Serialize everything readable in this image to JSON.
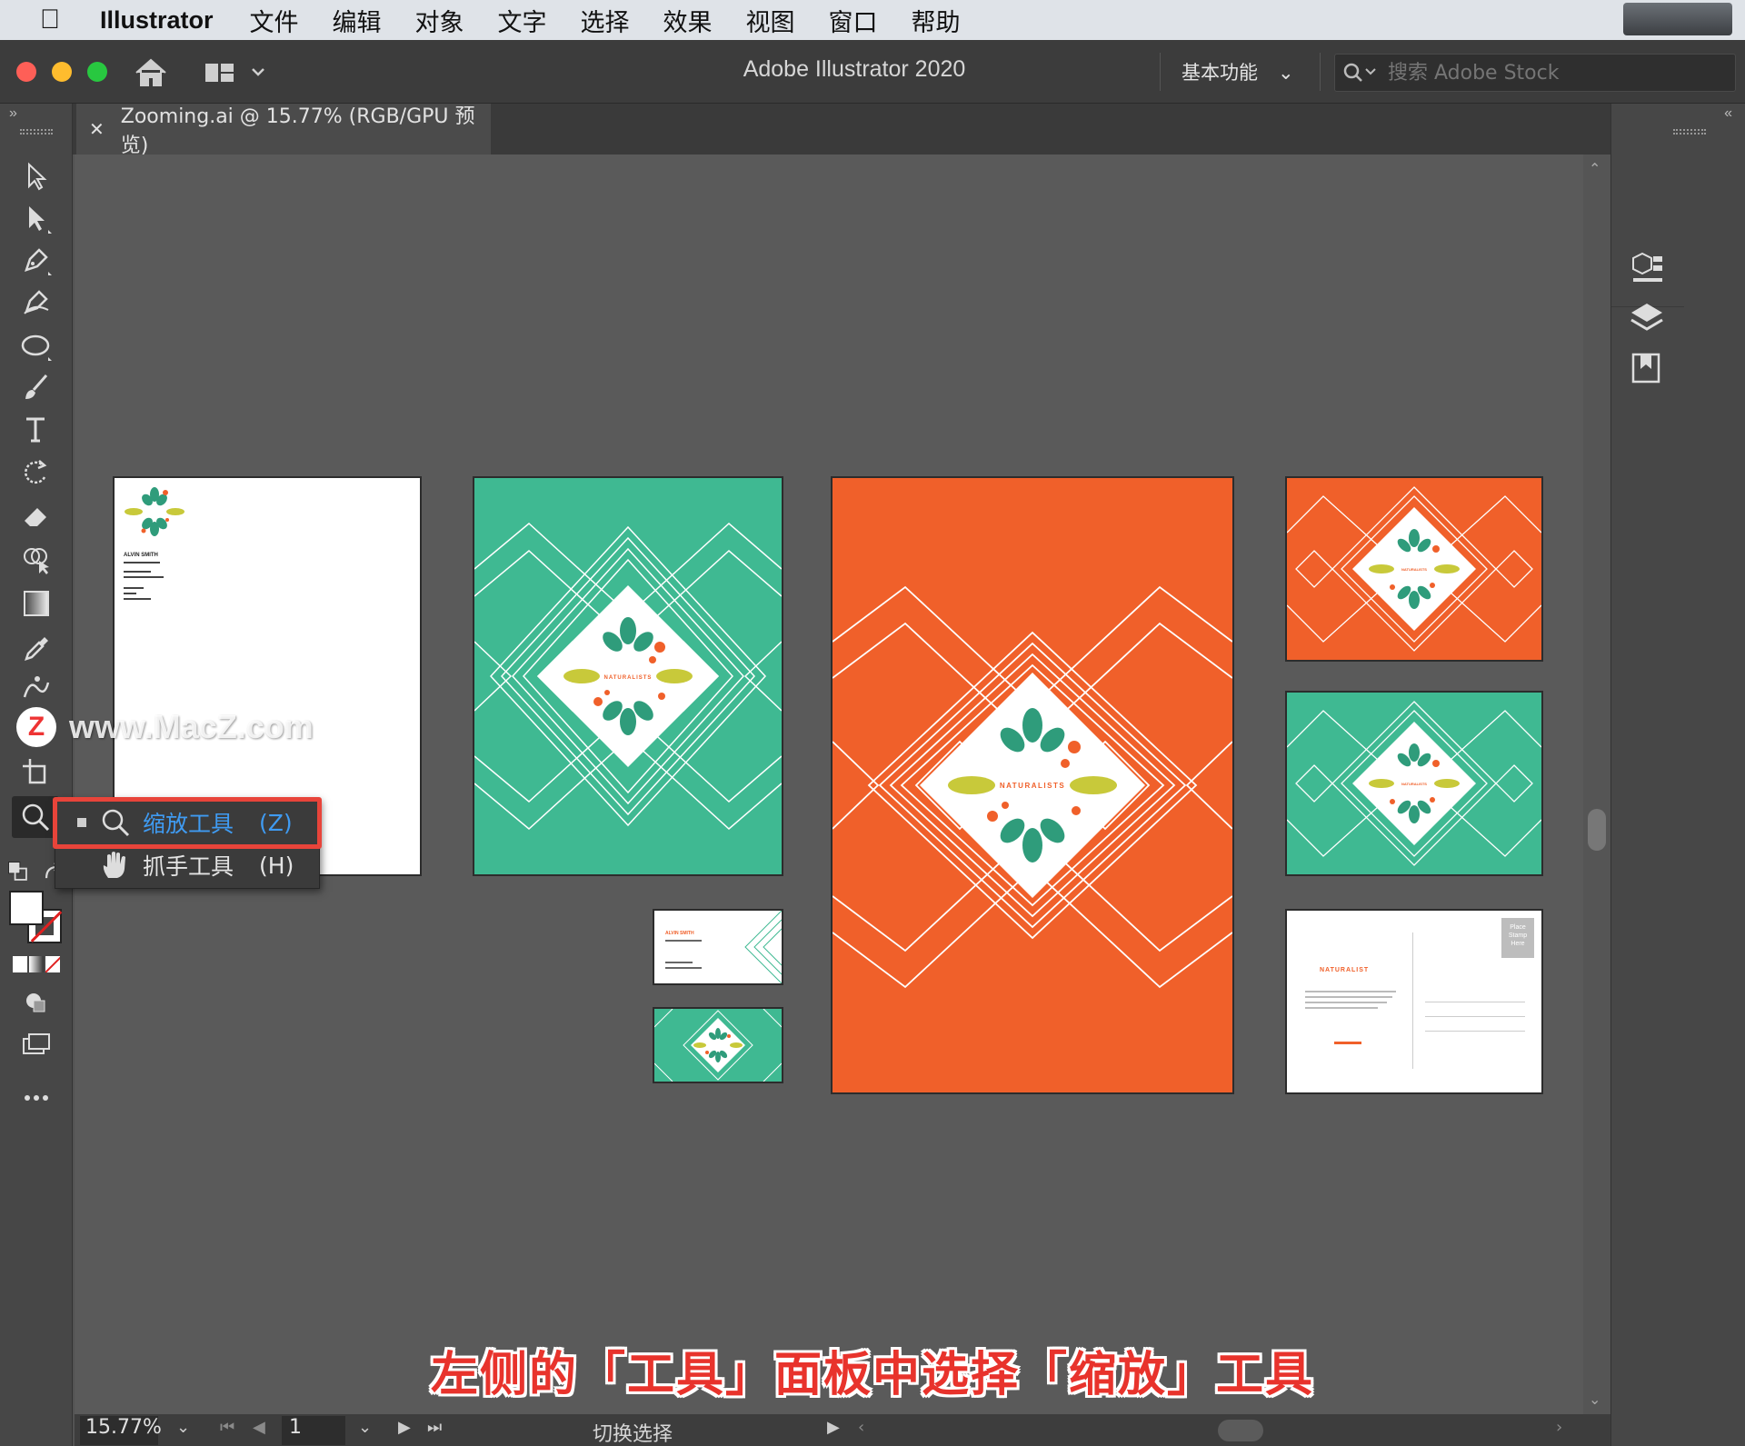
{
  "menubar": {
    "app_name": "Illustrator",
    "items": [
      "文件",
      "编辑",
      "对象",
      "文字",
      "选择",
      "效果",
      "视图",
      "窗口",
      "帮助"
    ]
  },
  "titlebar": {
    "title": "Adobe Illustrator 2020",
    "workspace_label": "基本功能",
    "stock_placeholder": "搜索 Adobe Stock"
  },
  "document": {
    "tab_title": "Zooming.ai @ 15.77% (RGB/GPU 预览)"
  },
  "tools": [
    "selection-tool",
    "direct-selection-tool",
    "pen-tool",
    "curvature-tool",
    "ellipse-tool",
    "paintbrush-tool",
    "type-tool",
    "rotate-tool",
    "eraser-tool",
    "shape-builder-tool",
    "gradient-tool",
    "eyedropper-tool",
    "puppet-warp-tool",
    "free-transform-tool",
    "artboard-tool",
    "zoom-tool"
  ],
  "flyout": {
    "zoom_label": "缩放工具",
    "zoom_key": "(Z)",
    "hand_label": "抓手工具",
    "hand_key": "(H)"
  },
  "artboards": {
    "letterhead_name": "ALVIN SMITH",
    "business_card_name": "ALVIN SMITH",
    "postcard_brand": "NATURALIST",
    "postcard_stamp": "Place Stamp Here",
    "poster_brand": "NATURALISTS"
  },
  "status": {
    "zoom": "15.77%",
    "page": "1",
    "mode": "切换选择"
  },
  "watermark": {
    "logo": "Z",
    "text": "www.MacZ.com"
  },
  "caption": "左侧的「工具」面板中选择「缩放」工具",
  "colors": {
    "teal": "#3fb992",
    "orange": "#f0602a",
    "leaf_green": "#2f9c7b",
    "leaf_yellow": "#c8c93a",
    "highlight_red": "#e8443a",
    "selected_blue": "#3f9bf2"
  }
}
